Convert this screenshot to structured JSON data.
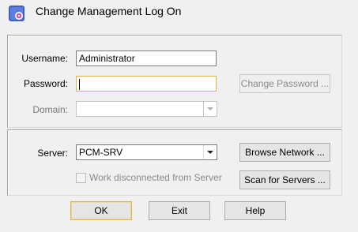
{
  "window": {
    "title": "Change Management Log On"
  },
  "form": {
    "username_label": "Username:",
    "username_value": "Administrator",
    "password_label": "Password:",
    "password_value": "",
    "domain_label": "Domain:",
    "domain_value": "",
    "change_password_label": "Change Password ...",
    "server_label": "Server:",
    "server_value": "PCM-SRV",
    "browse_network_label": "Browse Network ...",
    "work_disconnected_label": "Work disconnected from Server",
    "scan_servers_label": "Scan for Servers ..."
  },
  "footer": {
    "ok_label": "OK",
    "exit_label": "Exit",
    "help_label": "Help"
  },
  "colors": {
    "focus_border": "#e0b24b",
    "disabled_text": "#8a8a8a"
  }
}
